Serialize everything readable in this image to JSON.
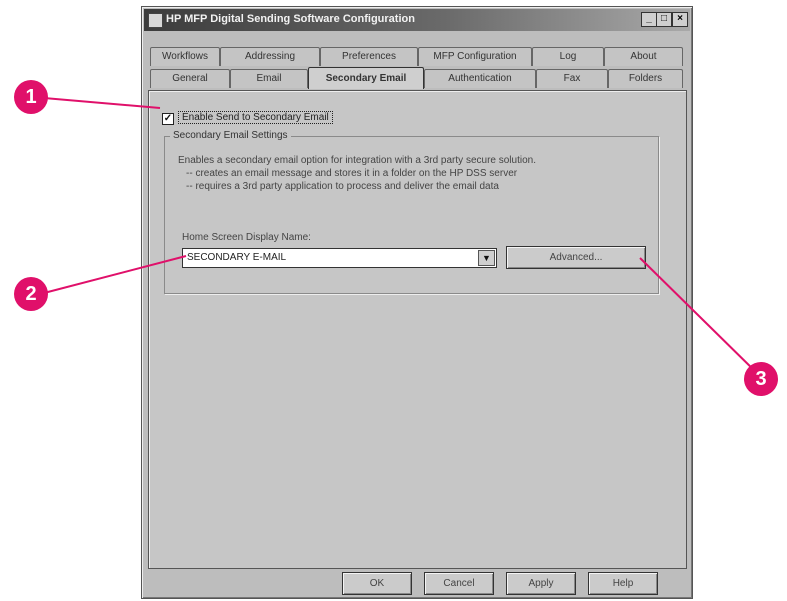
{
  "window": {
    "title": "HP MFP Digital Sending Software Configuration",
    "controls": {
      "minimize": "_",
      "maximize": "□",
      "close": "×"
    }
  },
  "tabs": {
    "back_row": [
      "Workflows",
      "Addressing",
      "Preferences",
      "MFP Configuration",
      "Log",
      "About"
    ],
    "front_row": [
      "General",
      "Email",
      "Secondary Email",
      "Authentication",
      "Fax",
      "Folders"
    ],
    "active": "Secondary Email"
  },
  "enable_checkbox": {
    "label": "Enable Send to Secondary Email",
    "checked": true,
    "mark": "✓"
  },
  "settings_group": {
    "title": "Secondary Email Settings",
    "description": [
      "Enables a secondary email option for integration with a 3rd party secure solution.",
      "-- creates an email message and stores it in a folder on the HP DSS server",
      "-- requires a 3rd party application to process and deliver the email data"
    ],
    "display_name_label": "Home Screen Display Name:",
    "display_name_value": "SECONDARY E-MAIL",
    "dropdown_arrow": "▼",
    "advanced_button": "Advanced..."
  },
  "footer": {
    "ok": "OK",
    "cancel": "Cancel",
    "apply": "Apply",
    "help": "Help"
  },
  "callouts": {
    "c1": "1",
    "c2": "2",
    "c3": "3"
  },
  "colors": {
    "callout": "#e0106a",
    "window": "#bdbdbd"
  }
}
